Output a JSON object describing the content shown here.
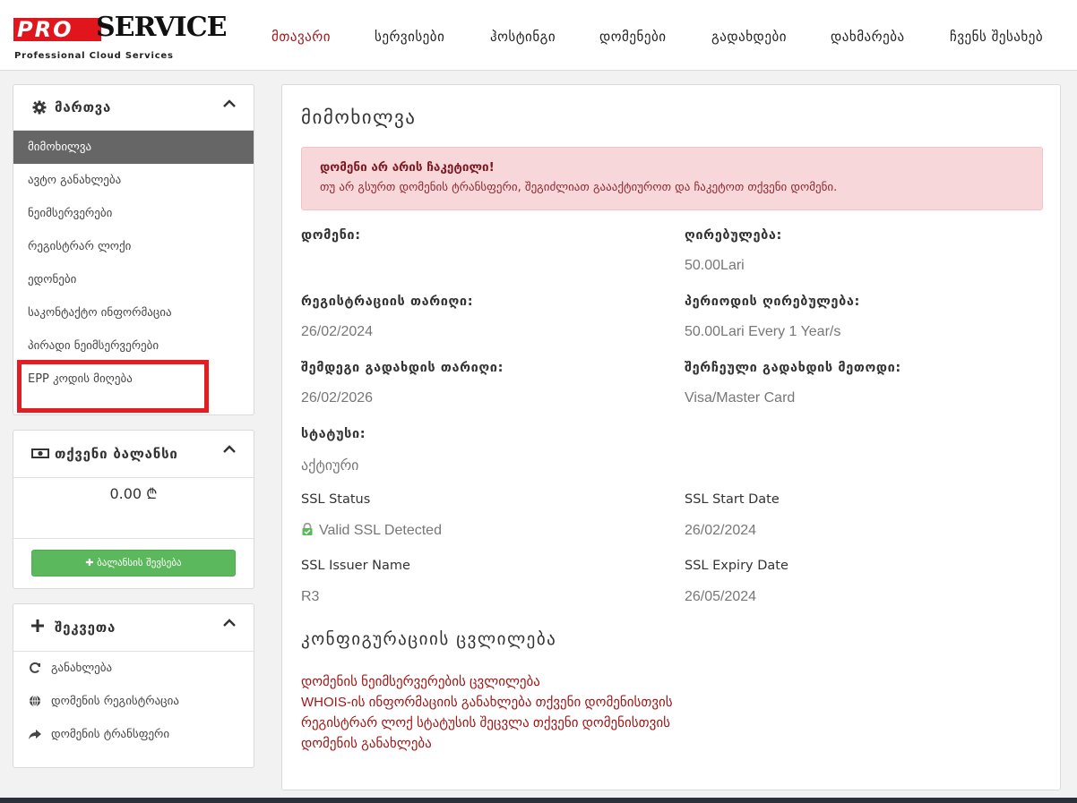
{
  "brand": {
    "logo_pro": "PRO",
    "logo_service": "SERVICE",
    "tagline": "Professional Cloud Services",
    "accent": "#e0161c"
  },
  "nav": {
    "items": [
      {
        "label": "მთავარი",
        "active": true
      },
      {
        "label": "სერვისები"
      },
      {
        "label": "ჰოსტინგი"
      },
      {
        "label": "დომენები"
      },
      {
        "label": "გადახდები"
      },
      {
        "label": "დახმარება"
      },
      {
        "label": "ჩვენს შესახებ"
      }
    ]
  },
  "sidebar": {
    "manage": {
      "title": "მართვა",
      "icon": "gear-icon",
      "items": [
        {
          "label": "მიმოხილვა",
          "active": true
        },
        {
          "label": "ავტო განახლება"
        },
        {
          "label": "ნეიმსერვერები"
        },
        {
          "label": "რეგისტრარ ლოქი"
        },
        {
          "label": "ედონები"
        },
        {
          "label": "საკონტაქტო ინფორმაცია"
        },
        {
          "label": "პირადი ნეიმსერვერები"
        },
        {
          "label": "EPP კოდის მიღება"
        }
      ]
    },
    "balance": {
      "title": "თქვენი ბალანსი",
      "icon": "money-icon",
      "amount": "0.00 ₾",
      "add_button": "ბალანსის შევსება",
      "button_color": "#5cb85c"
    },
    "shortcuts": {
      "title": "შეკვეთა",
      "icon": "plus-icon",
      "items": [
        {
          "label": "განახლება",
          "icon": "refresh-icon"
        },
        {
          "label": "დომენის რეგისტრაცია",
          "icon": "globe-icon"
        },
        {
          "label": "დომენის ტრანსფერი",
          "icon": "share-icon"
        }
      ]
    }
  },
  "main": {
    "title": "მიმოხილვა",
    "alert": {
      "title": "დომენი არ არის ჩაკეტილი!",
      "text": "თუ არ გსურთ დომენის ტრანსფერი, შეგიძლიათ გაააქტიუროთ და ჩაკეტოთ თქვენი დომენი."
    },
    "fields": {
      "domain_label": "დომენი:",
      "domain_value": "",
      "price_label": "ღირებულება:",
      "price_value": "50.00Lari",
      "reg_date_label": "რეგისტრაციის თარიღი:",
      "reg_date_value": "26/02/2024",
      "recurring_label": "პერიოდის ღირებულება:",
      "recurring_value": "50.00Lari Every 1 Year/s",
      "next_due_label": "შემდეგი გადახდის თარიღი:",
      "next_due_value": "26/02/2026",
      "pay_method_label": "შერჩეული გადახდის მეთოდი:",
      "pay_method_value": "Visa/Master Card",
      "status_label": "სტატუსი:",
      "status_value": "აქტიური"
    },
    "ssl": {
      "status_label": "SSL Status",
      "status_value": "Valid SSL Detected",
      "start_label": "SSL Start Date",
      "start_value": "26/02/2024",
      "issuer_label": "SSL Issuer Name",
      "issuer_value": "R3",
      "expiry_label": "SSL Expiry Date",
      "expiry_value": "26/05/2024"
    },
    "config": {
      "title": "კონფიგურაციის ცვლილება",
      "links": [
        "დომენის ნეიმსერვერების ცვლილება",
        "WHOIS-ის ინფორმაციის განახლება თქვენი დომენისთვის",
        "რეგისტრარ ლოქ სტატუსის შეცვლა თქვენი დომენისთვის",
        "დომენის განახლება"
      ],
      "link_color": "#a01818"
    }
  }
}
